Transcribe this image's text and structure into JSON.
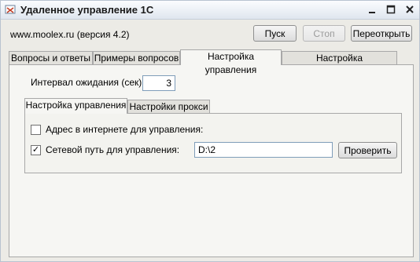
{
  "window": {
    "title": "Удаленное управление 1С"
  },
  "header": {
    "site_text": "www.moolex.ru (версия 4.2)",
    "start_label": "Пуск",
    "stop_label": "Стоп",
    "reopen_label": "Переоткрыть"
  },
  "tabs": [
    {
      "label": "Вопросы и ответы"
    },
    {
      "label": "Примеры вопросов"
    },
    {
      "label": "Настройка управления"
    },
    {
      "label": "Настройка пользователей"
    }
  ],
  "active_tab": "Настройка управления",
  "settings": {
    "interval_label": "Интервал ожидания (сек):",
    "interval_value": "3",
    "subtabs": [
      {
        "label": "Настройка управления"
      },
      {
        "label": "Настройки прокси"
      }
    ],
    "internet_address_label": "Адрес в интернете для управления:",
    "internet_address_checked": false,
    "network_path_label": "Сетевой путь для управления:",
    "network_path_checked": true,
    "network_path_value": "D:\\2",
    "check_label": "Проверить"
  }
}
